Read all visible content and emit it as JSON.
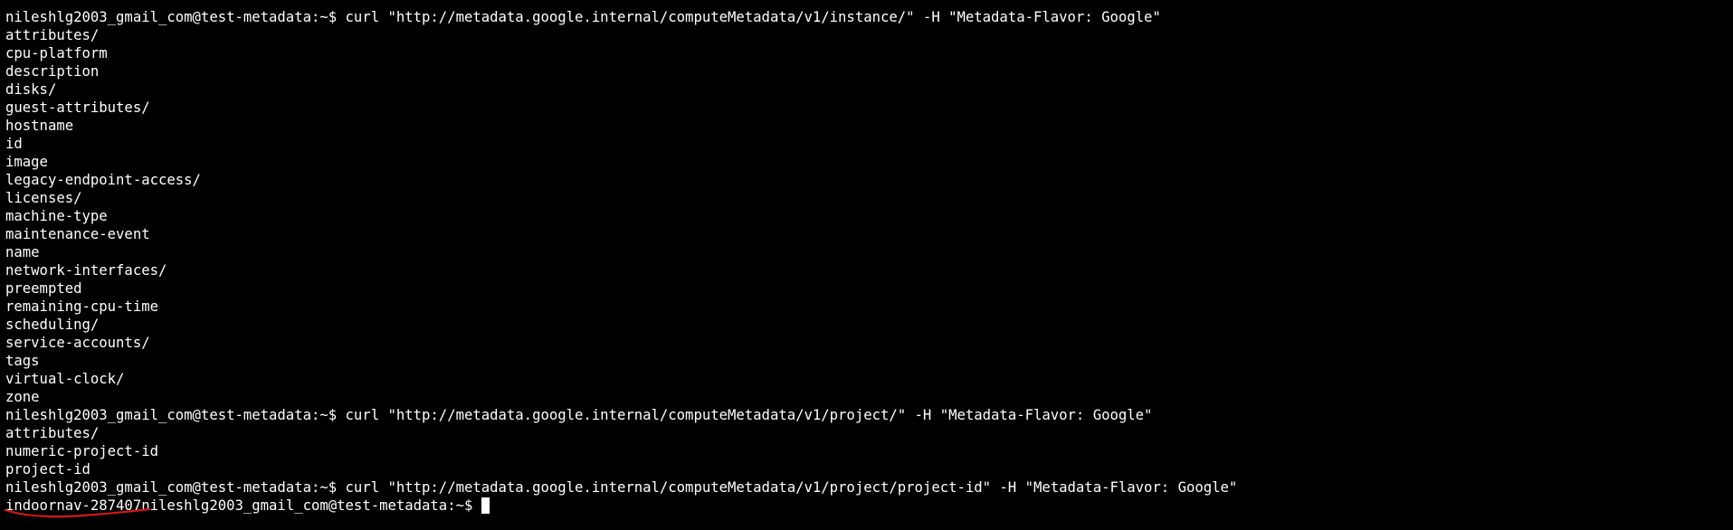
{
  "terminal": {
    "lines": [
      "nileshlg2003_gmail_com@test-metadata:~$ curl \"http://metadata.google.internal/computeMetadata/v1/instance/\" -H \"Metadata-Flavor: Google\"",
      "attributes/",
      "cpu-platform",
      "description",
      "disks/",
      "guest-attributes/",
      "hostname",
      "id",
      "image",
      "legacy-endpoint-access/",
      "licenses/",
      "machine-type",
      "maintenance-event",
      "name",
      "network-interfaces/",
      "preempted",
      "remaining-cpu-time",
      "scheduling/",
      "service-accounts/",
      "tags",
      "virtual-clock/",
      "zone",
      "nileshlg2003_gmail_com@test-metadata:~$ curl \"http://metadata.google.internal/computeMetadata/v1/project/\" -H \"Metadata-Flavor: Google\"",
      "attributes/",
      "numeric-project-id",
      "project-id",
      "nileshlg2003_gmail_com@test-metadata:~$ curl \"http://metadata.google.internal/computeMetadata/v1/project/project-id\" -H \"Metadata-Flavor: Google\""
    ],
    "final_line": {
      "output": "indoornav-287407",
      "prompt": "nileshlg2003_gmail_com@test-metadata:~$"
    }
  },
  "colors": {
    "background": "#000000",
    "text": "#ffffff",
    "annotation": "#d01818"
  }
}
